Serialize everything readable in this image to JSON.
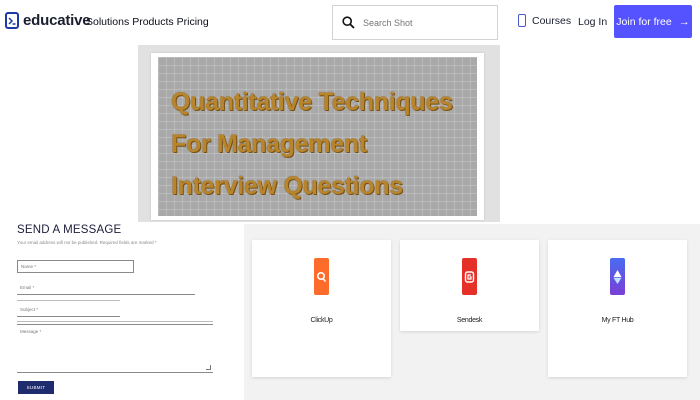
{
  "nav": {
    "logo_text": "educative",
    "menu": [
      "Solutions",
      "Products",
      "Pricing"
    ],
    "search_placeholder": "Search Shot",
    "courses_label": "Courses",
    "login_label": "Log In",
    "join_label": "Join for free",
    "join_arrow": "→",
    "accent_color": "#5553ff"
  },
  "hero": {
    "title": "Quantitative Techniques For Management Interview Questions",
    "title_color": "#b8842c"
  },
  "form": {
    "heading": "SEND A MESSAGE",
    "note": "Your email address will not be published. Required fields are marked *",
    "name_label": "Name *",
    "email_label": "Email *",
    "subject_label": "Subject *",
    "message_label": "Message *",
    "submit_label": "SUBMIT"
  },
  "tools": [
    {
      "label": "ClickUp",
      "icon": "clickup-icon",
      "color": "#ff6b2b"
    },
    {
      "label": "Sendesk",
      "icon": "sendesk-icon",
      "color": "#e5302a"
    },
    {
      "label": "My FT Hub",
      "icon": "myfthub-icon",
      "color": "#3a4ee8"
    }
  ]
}
